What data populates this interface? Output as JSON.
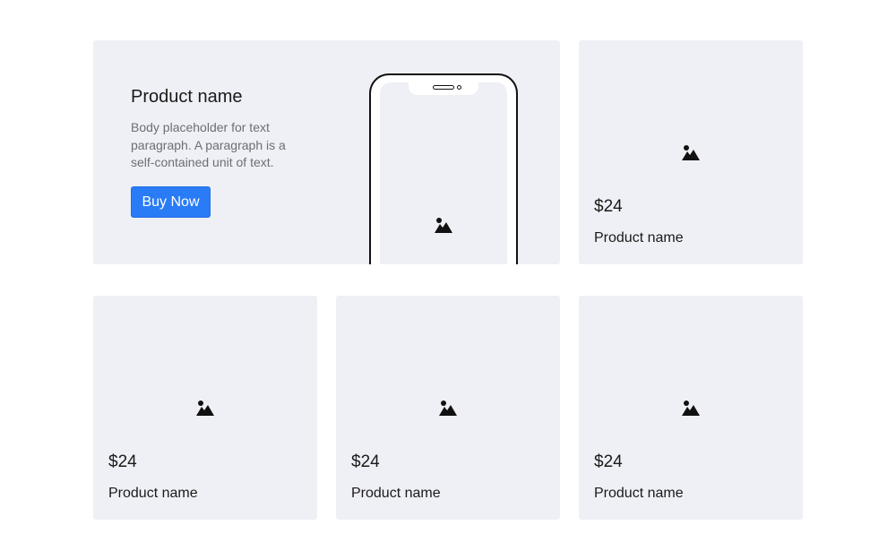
{
  "hero": {
    "title": "Product name",
    "body": "Body placeholder for text paragraph. A paragraph is a self-contained unit of text.",
    "button_label": "Buy Now",
    "image_icon": "image-placeholder-icon"
  },
  "products": [
    {
      "price": "$24",
      "name": "Product name",
      "icon": "image-placeholder-icon"
    },
    {
      "price": "$24",
      "name": "Product name",
      "icon": "image-placeholder-icon"
    },
    {
      "price": "$24",
      "name": "Product name",
      "icon": "image-placeholder-icon"
    },
    {
      "price": "$24",
      "name": "Product name",
      "icon": "image-placeholder-icon"
    }
  ],
  "colors": {
    "card_background": "#eff0f5",
    "button_background": "#2a7cf6",
    "body_text": "#6b6e76",
    "heading_text": "#1a1a1a"
  }
}
